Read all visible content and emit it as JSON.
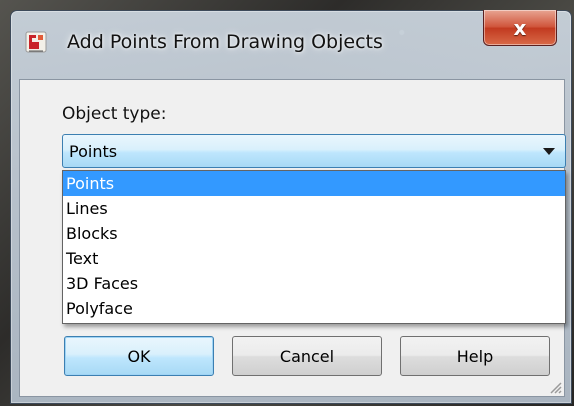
{
  "window": {
    "title": "Add Points From Drawing Objects",
    "close_label": "x"
  },
  "form": {
    "object_type_label": "Object type:",
    "object_type_value": "Points",
    "options": [
      "Points",
      "Lines",
      "Blocks",
      "Text",
      "3D Faces",
      "Polyface"
    ],
    "selected_index": 0
  },
  "buttons": {
    "ok_label": "OK",
    "cancel_label": "Cancel",
    "help_label": "Help"
  },
  "colors": {
    "selection": "#3399ff",
    "close_button": "#c23a20",
    "combo_border": "#3c7fb1"
  },
  "icons": {
    "app": "app-icon",
    "dropdown": "chevron-down-icon",
    "close": "close-icon",
    "resize": "resize-grip-icon"
  }
}
